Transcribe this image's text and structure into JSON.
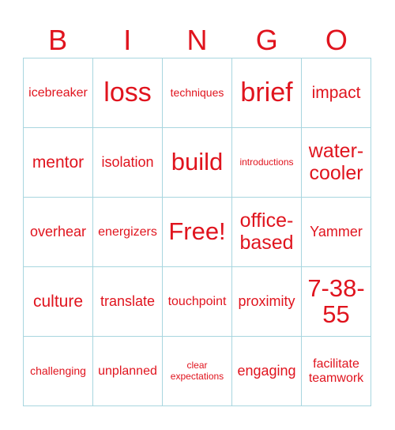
{
  "header": {
    "letters": [
      "B",
      "I",
      "N",
      "G",
      "O"
    ]
  },
  "theme": {
    "text_color": "#e0141e",
    "grid_color": "#a8d6df"
  },
  "cells": [
    "icebreaker",
    "loss",
    "techniques",
    "brief",
    "impact",
    "mentor",
    "isolation",
    "build",
    "introductions",
    "water-cooler",
    "overhear",
    "energizers",
    "Free!",
    "office-based",
    "Yammer",
    "culture",
    "translate",
    "touchpoint",
    "proximity",
    "7-38-55",
    "challenging",
    "unplanned",
    "clear expectations",
    "engaging",
    "facilitate teamwork"
  ]
}
